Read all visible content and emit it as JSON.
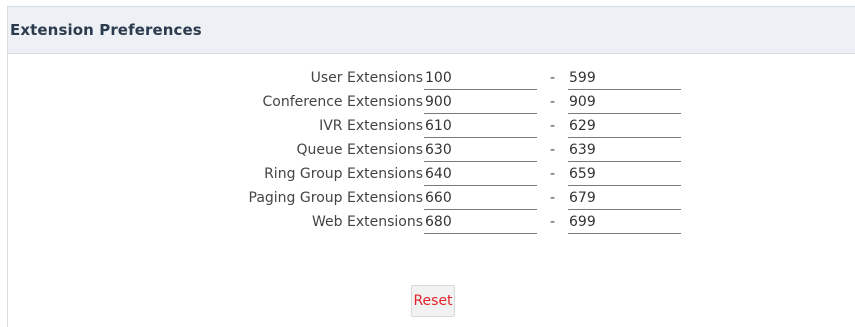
{
  "panel": {
    "title": "Extension Preferences"
  },
  "extensions": [
    {
      "label": "User Extensions",
      "start": "100",
      "end": "599"
    },
    {
      "label": "Conference Extensions",
      "start": "900",
      "end": "909"
    },
    {
      "label": "IVR Extensions",
      "start": "610",
      "end": "629"
    },
    {
      "label": "Queue Extensions",
      "start": "630",
      "end": "639"
    },
    {
      "label": "Ring Group Extensions",
      "start": "640",
      "end": "659"
    },
    {
      "label": "Paging Group Extensions",
      "start": "660",
      "end": "679"
    },
    {
      "label": "Web Extensions",
      "start": "680",
      "end": "699"
    }
  ],
  "separator": "-",
  "reset_label": "Reset",
  "colors": {
    "header_bg": "#edf1f5",
    "title": "#2c3b4d",
    "reset_text": "#e0232b"
  }
}
